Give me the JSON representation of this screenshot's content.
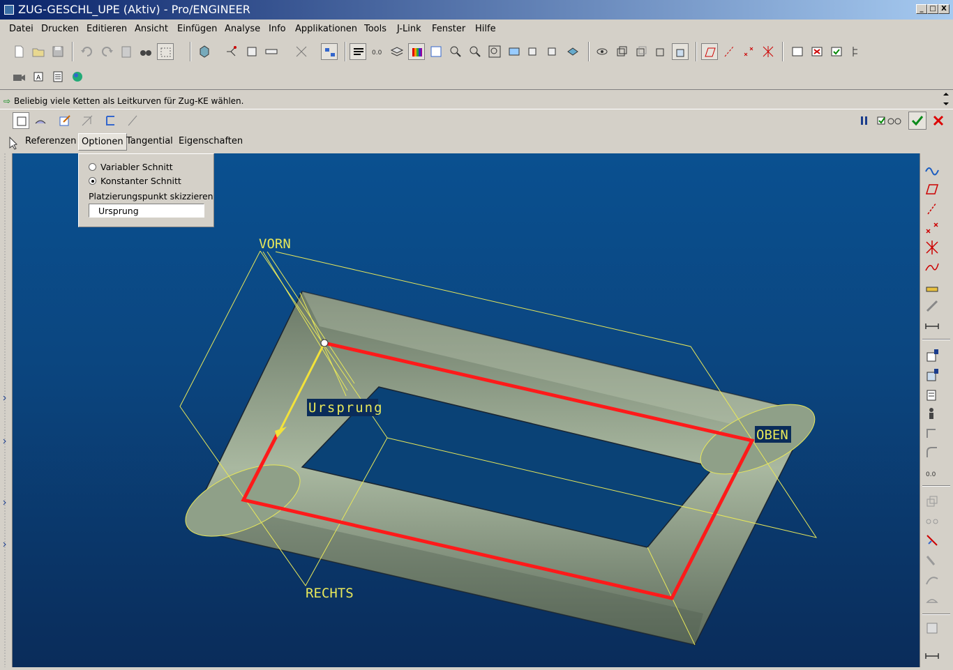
{
  "window": {
    "title": "ZUG-GESCHL_UPE (Aktiv) - Pro/ENGINEER",
    "minimize": "_",
    "maximize": "□",
    "close": "X"
  },
  "menu": [
    "Datei",
    "Drucken",
    "Editieren",
    "Ansicht",
    "Einfügen",
    "Analyse",
    "Info",
    "Applikationen",
    "Tools",
    "J-Link",
    "Fenster",
    "Hilfe"
  ],
  "message": "Beliebig viele Ketten als Leitkurven für Zug-KE wählen.",
  "tabs": {
    "referenzen": "Referenzen",
    "optionen": "Optionen",
    "tangential": "Tangential",
    "eigenschaften": "Eigenschaften"
  },
  "options_panel": {
    "variable": "Variabler Schnitt",
    "constant": "Konstanter Schnitt",
    "selected": "Konstanter Schnitt",
    "placement_label": "Platzierungspunkt skizzieren",
    "placement_value": "Ursprung"
  },
  "viewport": {
    "labels": {
      "vorn": "VORN",
      "oben": "OBEN",
      "rechts": "RECHTS",
      "ursprung": "Ursprung"
    },
    "colors": {
      "bg_top": "#0a5090",
      "bg_bottom": "#0a2c5a",
      "solid": "#a9b8a0",
      "trajectory": "#ff1a1a",
      "datum": "#e8e85a"
    }
  },
  "icons": {
    "dashboard_right": [
      "pause-icon",
      "check-icon",
      "glasses-icon",
      "ok-icon",
      "cancel-icon"
    ]
  }
}
